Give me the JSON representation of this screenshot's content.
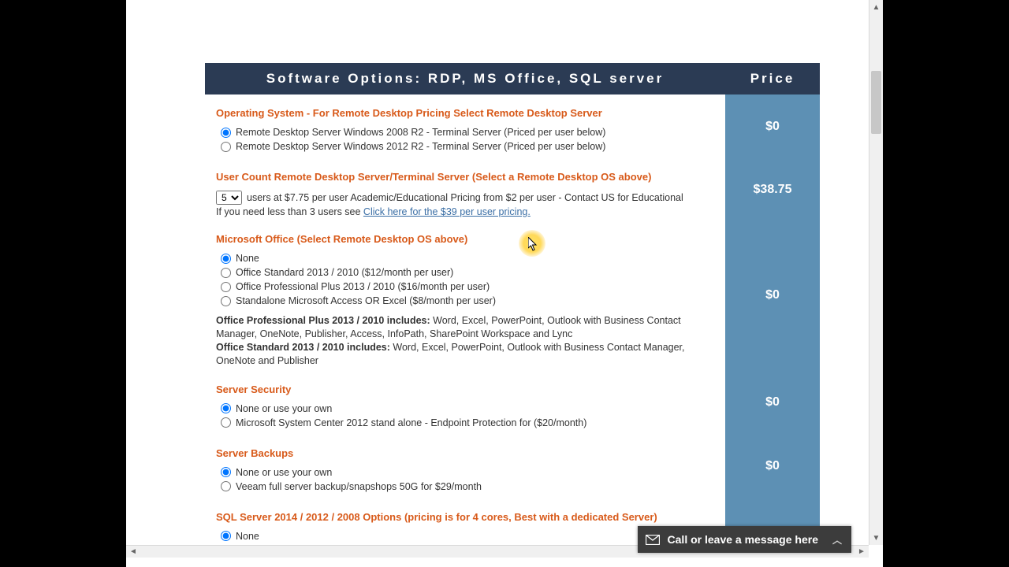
{
  "header": {
    "left": "Software Options: RDP, MS Office, SQL server",
    "right": "Price"
  },
  "os": {
    "title": "Operating System  - For Remote Desktop Pricing Select Remote Desktop Server",
    "options": [
      "Remote Desktop Server Windows 2008 R2 - Terminal Server (Priced per user below)",
      "Remote Desktop Server Windows 2012 R2 - Terminal Server (Priced per user below)"
    ],
    "selected": 0,
    "price": "$0"
  },
  "usercount": {
    "title": "User Count  Remote Desktop Server/Terminal Server (Select a Remote Desktop OS above)",
    "select_value": "5",
    "line_after_select": "users at $7.75 per user   Academic/Educational Pricing from $2 per user - Contact US for Educational",
    "fineprint_prefix": "If you need less than 3 users see ",
    "fineprint_link": "Click here for the $39 per user pricing.",
    "price": "$38.75"
  },
  "office": {
    "title": "Microsoft Office (Select Remote Desktop OS above)",
    "options": [
      "None",
      "Office Standard 2013 / 2010 ($12/month per user)",
      "Office Professional Plus 2013 / 2010 ($16/month per user)",
      "Standalone Microsoft Access OR Excel ($8/month per user)"
    ],
    "selected": 0,
    "desc1_label": "Office Professional Plus 2013 / 2010 includes:",
    "desc1_text": " Word, Excel, PowerPoint, Outlook with Business Contact Manager, OneNote, Publisher, Access, InfoPath, SharePoint Workspace and Lync",
    "desc2_label": "Office Standard 2013 / 2010 includes:",
    "desc2_text": " Word, Excel, PowerPoint, Outlook with Business Contact Manager, OneNote and Publisher",
    "price": "$0"
  },
  "security": {
    "title": "Server Security",
    "options": [
      "None or use your own",
      "Microsoft System Center 2012 stand alone - Endpoint Protection for ($20/month)"
    ],
    "selected": 0,
    "price": "$0"
  },
  "backups": {
    "title": "Server Backups",
    "options": [
      "None or use your own",
      "Veeam full server backup/snapshops 50G for $29/month"
    ],
    "selected": 0,
    "price": "$0"
  },
  "sql": {
    "title": "SQL Server 2014 / 2012 / 2008 Options (pricing is for 4 cores, Best with a dedicated Server)",
    "options": [
      "None"
    ],
    "selected": 0
  },
  "chat": {
    "label": "Call or leave a message here"
  }
}
